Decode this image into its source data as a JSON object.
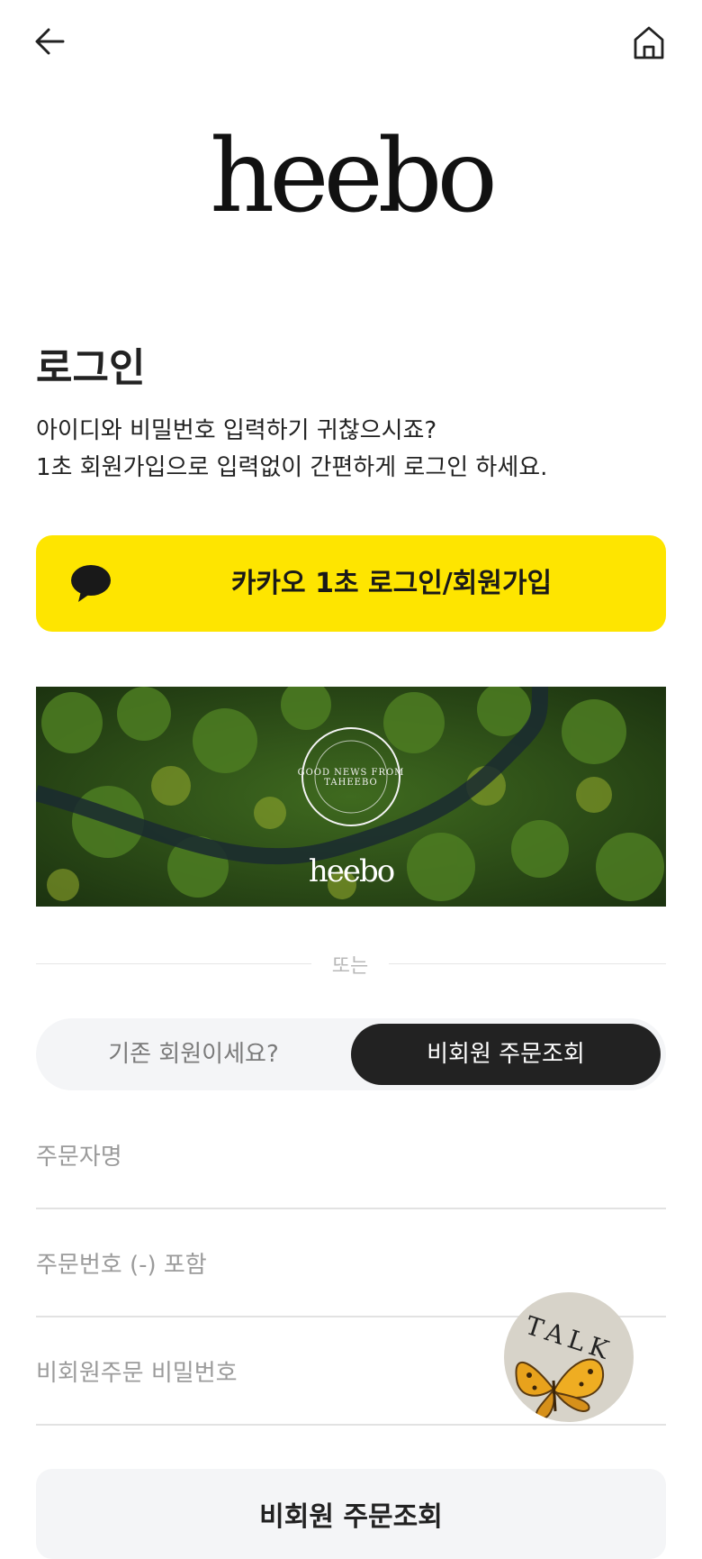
{
  "brand": {
    "logo_text": "heebo"
  },
  "header": {
    "back_icon": "back-arrow-icon",
    "home_icon": "home-icon"
  },
  "login": {
    "title": "로그인",
    "desc_line1": "아이디와 비밀번호 입력하기 귀찮으시죠?",
    "desc_line2": "1초 회원가입으로 입력없이 간편하게 로그인 하세요."
  },
  "kakao": {
    "label": "카카오 1초 로그인/회원가입",
    "icon": "speech-bubble-icon",
    "color": "#FEE500"
  },
  "banner": {
    "badge_text": "GOOD NEWS FROM TAHEEBO",
    "brand_text": "heebo"
  },
  "divider": {
    "text": "또는"
  },
  "tabs": {
    "member": "기존 회원이세요?",
    "guest": "비회원 주문조회"
  },
  "form": {
    "orderer_placeholder": "주문자명",
    "order_number_placeholder": "주문번호 (-) 포함",
    "password_placeholder": "비회원주문 비밀번호"
  },
  "submit": {
    "label": "비회원 주문조회"
  },
  "talk": {
    "label": "TALK",
    "icon": "butterfly-icon"
  },
  "colors": {
    "accent_dark": "#222222",
    "kakao_yellow": "#FEE500",
    "talk_bg": "#D7D3C9"
  }
}
